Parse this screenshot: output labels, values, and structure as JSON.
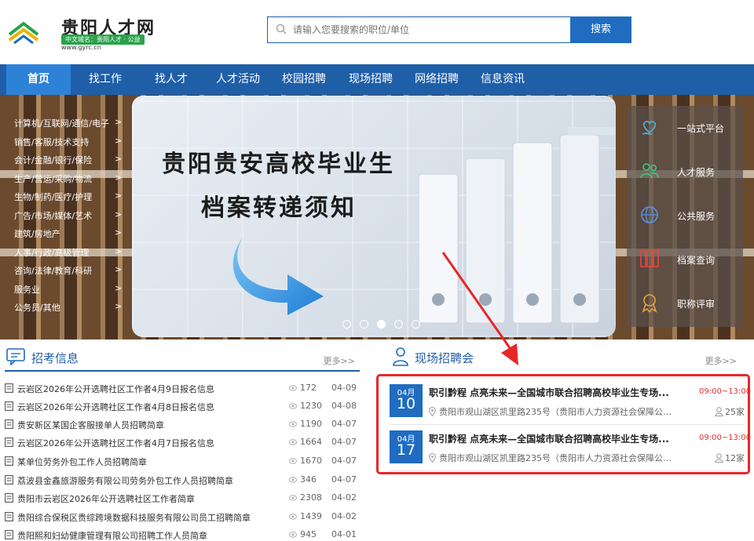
{
  "header": {
    "logo_title": "贵阳人才网",
    "logo_sub": "中文域名：贵阳人才 · 公益",
    "logo_url": "www.gyrc.cn",
    "search_placeholder": "请输入您要搜索的职位/单位",
    "search_button": "搜索"
  },
  "nav": {
    "items": [
      {
        "label": "首页"
      },
      {
        "label": "找工作"
      },
      {
        "label": "找人才"
      },
      {
        "label": "人才活动"
      },
      {
        "label": "校园招聘"
      },
      {
        "label": "现场招聘"
      },
      {
        "label": "网络招聘"
      },
      {
        "label": "信息资讯"
      }
    ]
  },
  "banner": {
    "title_line1": "贵阳贵安高校毕业生",
    "title_line2": "档案转递须知",
    "active_slide": 3,
    "slide_count": 5
  },
  "categories": [
    {
      "label": "计算机/互联网/通信/电子"
    },
    {
      "label": "销售/客服/技术支持"
    },
    {
      "label": "会计/金融/银行/保险"
    },
    {
      "label": "生产/营运/采购/物流"
    },
    {
      "label": "生物/制药/医疗/护理"
    },
    {
      "label": "广告/市场/媒体/艺术"
    },
    {
      "label": "建筑/房地产"
    },
    {
      "label": "人事/行政/高级管理"
    },
    {
      "label": "咨询/法律/教育/科研"
    },
    {
      "label": "服务业"
    },
    {
      "label": "公务员/其他"
    }
  ],
  "category_arrow": ">",
  "services": [
    {
      "label": "一站式平台",
      "icon": "heart-hand-icon"
    },
    {
      "label": "人才服务",
      "icon": "people-icon"
    },
    {
      "label": "公共服务",
      "icon": "globe-icon"
    },
    {
      "label": "档案查询",
      "icon": "files-icon"
    },
    {
      "label": "职称评审",
      "icon": "medal-icon"
    }
  ],
  "exam": {
    "title": "招考信息",
    "more": "更多>>",
    "rows": [
      {
        "title": "云岩区2026年公开选聘社区工作者4月9日报名信息",
        "views": "172",
        "date": "04-09"
      },
      {
        "title": "云岩区2026年公开选聘社区工作者4月8日报名信息",
        "views": "1230",
        "date": "04-08"
      },
      {
        "title": "贵安新区某国企客服接单人员招聘简章",
        "views": "1190",
        "date": "04-07"
      },
      {
        "title": "云岩区2026年公开选聘社区工作者4月7日报名信息",
        "views": "1664",
        "date": "04-07"
      },
      {
        "title": "某单位劳务外包工作人员招聘简章",
        "views": "1670",
        "date": "04-07"
      },
      {
        "title": "荔波县金鑫旅游服务有限公司劳务外包工作人员招聘简章",
        "views": "346",
        "date": "04-07"
      },
      {
        "title": "贵阳市云岩区2026年公开选聘社区工作者简章",
        "views": "2308",
        "date": "04-02"
      },
      {
        "title": "贵阳综合保税区贵综跨境数据科技服务有限公司员工招聘简章",
        "views": "1439",
        "date": "04-02"
      },
      {
        "title": "贵阳熙和妇幼健康管理有限公司招聘工作人员简章",
        "views": "945",
        "date": "04-01"
      }
    ]
  },
  "fairs": {
    "title": "现场招聘会",
    "more": "更多>>",
    "items": [
      {
        "month": "04月",
        "day": "10",
        "title": "职引黔程 点亮未来—全国城市联合招聘高校毕业生专场...",
        "time": "09:00~13:00",
        "location": "贵阳市观山湖区凯里路235号（贵阳市人力资源社会保障公共...",
        "count": "25家"
      },
      {
        "month": "04月",
        "day": "17",
        "title": "职引黔程 点亮未来—全国城市联合招聘高校毕业生专场...",
        "time": "09:00~13:00",
        "location": "贵阳市观山湖区凯里路235号（贵阳市人力资源社会保障公共...",
        "count": "12家"
      }
    ]
  },
  "colors": {
    "primary": "#1f5fa8",
    "nav_active": "#2d82d8",
    "annotation": "#e8262a",
    "time": "#e03030"
  }
}
